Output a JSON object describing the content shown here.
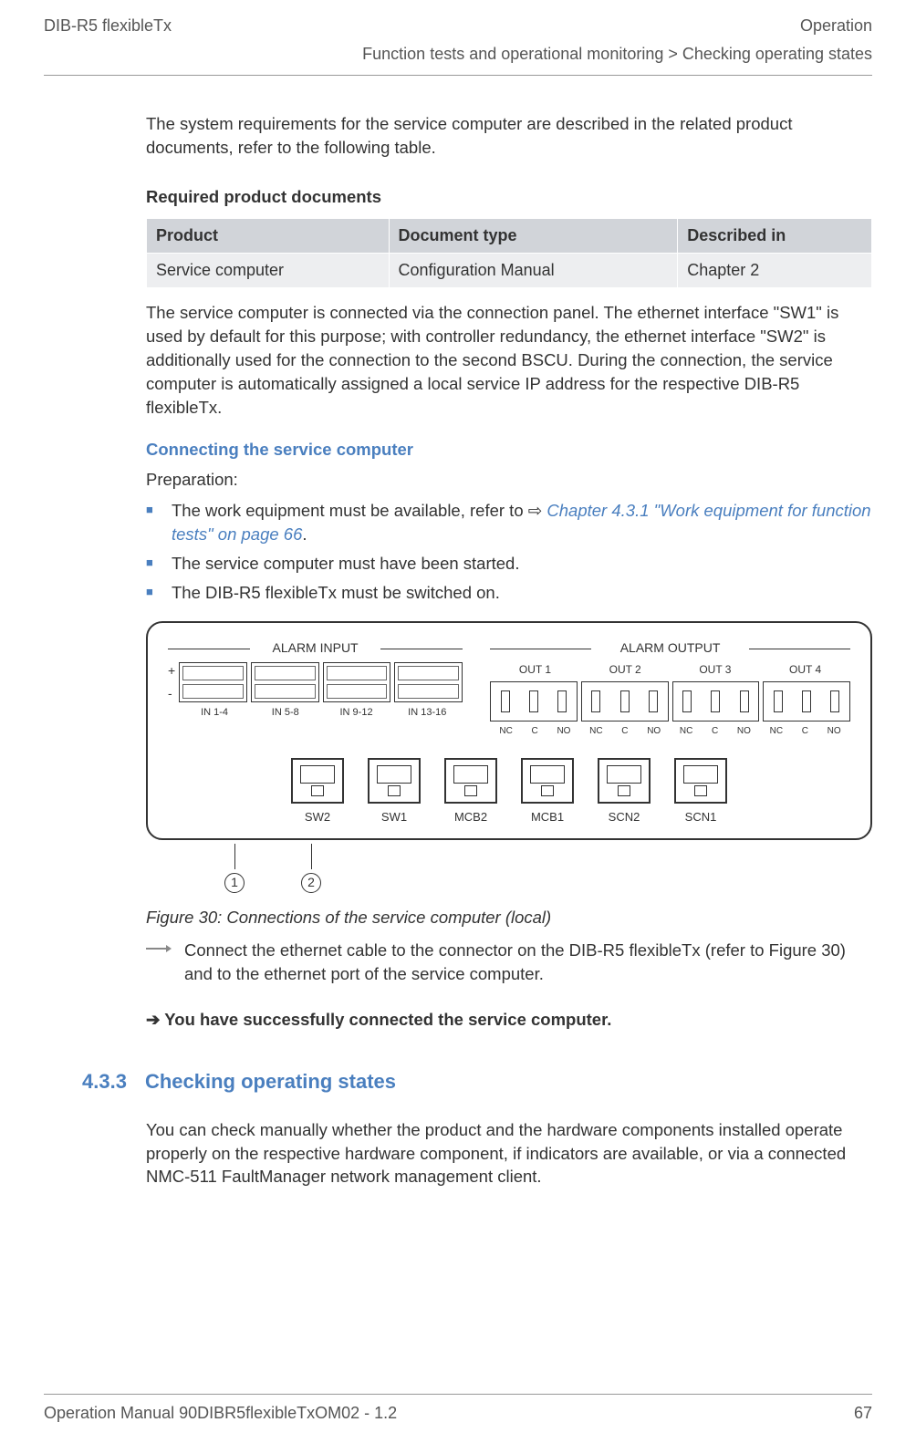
{
  "header": {
    "left": "DIB-R5 flexibleTx",
    "right": "Operation"
  },
  "breadcrumb": "Function tests and operational monitoring > Checking operating states",
  "para1": "The system requirements for the service computer are described in the related product documents, refer to the following table.",
  "req_title": "Required product documents",
  "table": {
    "headers": [
      "Product",
      "Document type",
      "Described in"
    ],
    "rows": [
      [
        "Service computer",
        "Configuration Manual",
        "Chapter 2"
      ]
    ]
  },
  "para2": "The service computer is connected via the connection panel. The ethernet interface \"SW1\" is used by default for this purpose; with controller redundancy, the ethernet interface \"SW2\" is additionally used for the connection to the second BSCU. During the connection, the service computer is automatically assigned a local service IP address for the respective DIB-R5 flexibleTx.",
  "connecting_heading": "Connecting the service computer",
  "preparation_label": "Preparation:",
  "bullets": {
    "b1_pre": "The work equipment must be available, refer to ",
    "b1_link": "Chapter 4.3.1 \"Work equipment for function tests\" on page 66",
    "b1_post": ".",
    "b2": "The service computer must have been started.",
    "b3": "The DIB-R5 flexibleTx must be switched on."
  },
  "diagram": {
    "alarm_input": "ALARM INPUT",
    "alarm_output": "ALARM OUTPUT",
    "plus": "+",
    "minus": "-",
    "in_labels": [
      "IN 1-4",
      "IN 5-8",
      "IN 9-12",
      "IN 13-16"
    ],
    "out_labels": [
      "OUT 1",
      "OUT 2",
      "OUT 3",
      "OUT 4"
    ],
    "relay_labels": [
      "NC",
      "C",
      "NO"
    ],
    "ports": [
      "SW2",
      "SW1",
      "MCB2",
      "MCB1",
      "SCN2",
      "SCN1"
    ],
    "callouts": [
      "1",
      "2"
    ]
  },
  "figure_caption": "Figure 30: Connections of the service computer (local)",
  "step_text": "Connect the ethernet cable to the connector on the DIB-R5 flexibleTx (refer to Figure 30) and to the ethernet port of the service computer.",
  "result_text": "➔ You have successfully connected the service computer.",
  "section_433": {
    "num": "4.3.3",
    "title": "Checking operating states"
  },
  "para3": "You can check manually whether the product and the hardware components installed operate properly on the respective hardware component, if indicators are available, or via a connected NMC-511 FaultManager network management client.",
  "footer": {
    "left": "Operation Manual 90DIBR5flexibleTxOM02 - 1.2",
    "right": "67"
  }
}
